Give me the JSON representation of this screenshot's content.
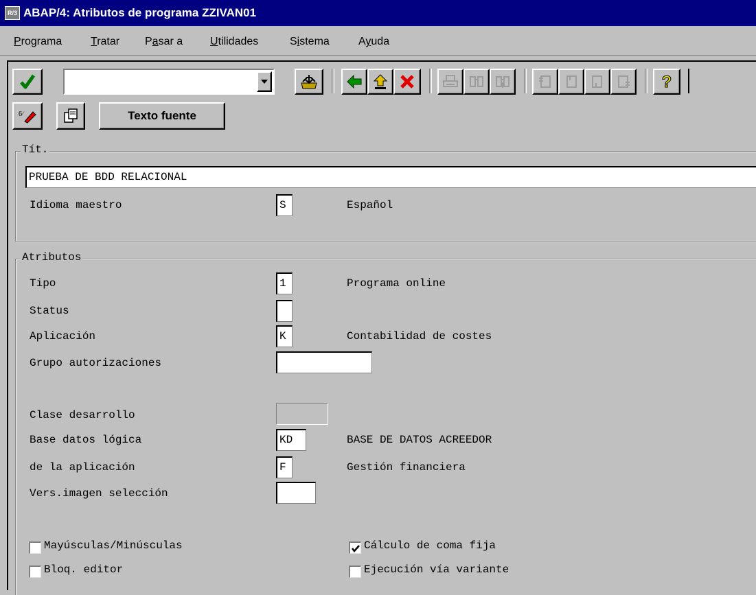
{
  "window": {
    "title": "ABAP/4: Atributos de programa ZZIVAN01",
    "sap_icon": "R/3"
  },
  "menu": [
    {
      "label": "Programa",
      "u": "P",
      "rest": "rograma"
    },
    {
      "label": "Tratar",
      "u": "T",
      "rest": "ratar"
    },
    {
      "label": "Pasar a",
      "pre": "P",
      "u": "a",
      "rest": "sar a"
    },
    {
      "label": "Utilidades",
      "u": "U",
      "rest": "tilidades"
    },
    {
      "label": "Sistema",
      "pre": "S",
      "u": "i",
      "rest": "stema"
    },
    {
      "label": "Ayuda",
      "pre": "A",
      "u": "y",
      "rest": "uda"
    }
  ],
  "toolbar": {
    "command_value": "",
    "icons": [
      "check-icon",
      "dropdown-icon",
      "save-icon",
      "back-icon",
      "exit-icon",
      "cancel-icon",
      "print-icon",
      "find-icon",
      "find-next-icon",
      "first-page-icon",
      "previous-page-icon",
      "next-page-icon",
      "last-page-icon",
      "help-icon"
    ]
  },
  "appbar": {
    "source_text_button": "Texto fuente"
  },
  "title_group": {
    "legend": "Tít.",
    "title_value": "PRUEBA DE BDD RELACIONAL",
    "master_lang_label": "Idioma maestro",
    "master_lang_value": "S",
    "master_lang_text": "Español"
  },
  "attributes": {
    "legend": "Atributos",
    "tipo_label": "Tipo",
    "tipo_value": "1",
    "tipo_text": "Programa online",
    "status_label": "Status",
    "status_value": "",
    "aplicacion_label": "Aplicación",
    "aplicacion_value": "K",
    "aplicacion_text": "Contabilidad de costes",
    "grupo_label": "Grupo autorizaciones",
    "grupo_value": "",
    "clase_label": "Clase desarrollo",
    "clase_value": "",
    "bdl_label": "Base datos lógica",
    "bdl_value": "KD",
    "bdl_text": "BASE DE DATOS ACREEDOR",
    "app2_label": "de la aplicación",
    "app2_value": "F",
    "app2_text": "Gestión financiera",
    "vers_label": "Vers.imagen selección",
    "vers_value": "",
    "cb_mayus_label": "Mayúsculas/Minúsculas",
    "cb_mayus_checked": false,
    "cb_calculo_label": "Cálculo de coma fija",
    "cb_calculo_checked": true,
    "cb_bloq_label": "Bloq. editor",
    "cb_bloq_checked": false,
    "cb_ejec_label": "Ejecución vía variante",
    "cb_ejec_checked": false
  }
}
